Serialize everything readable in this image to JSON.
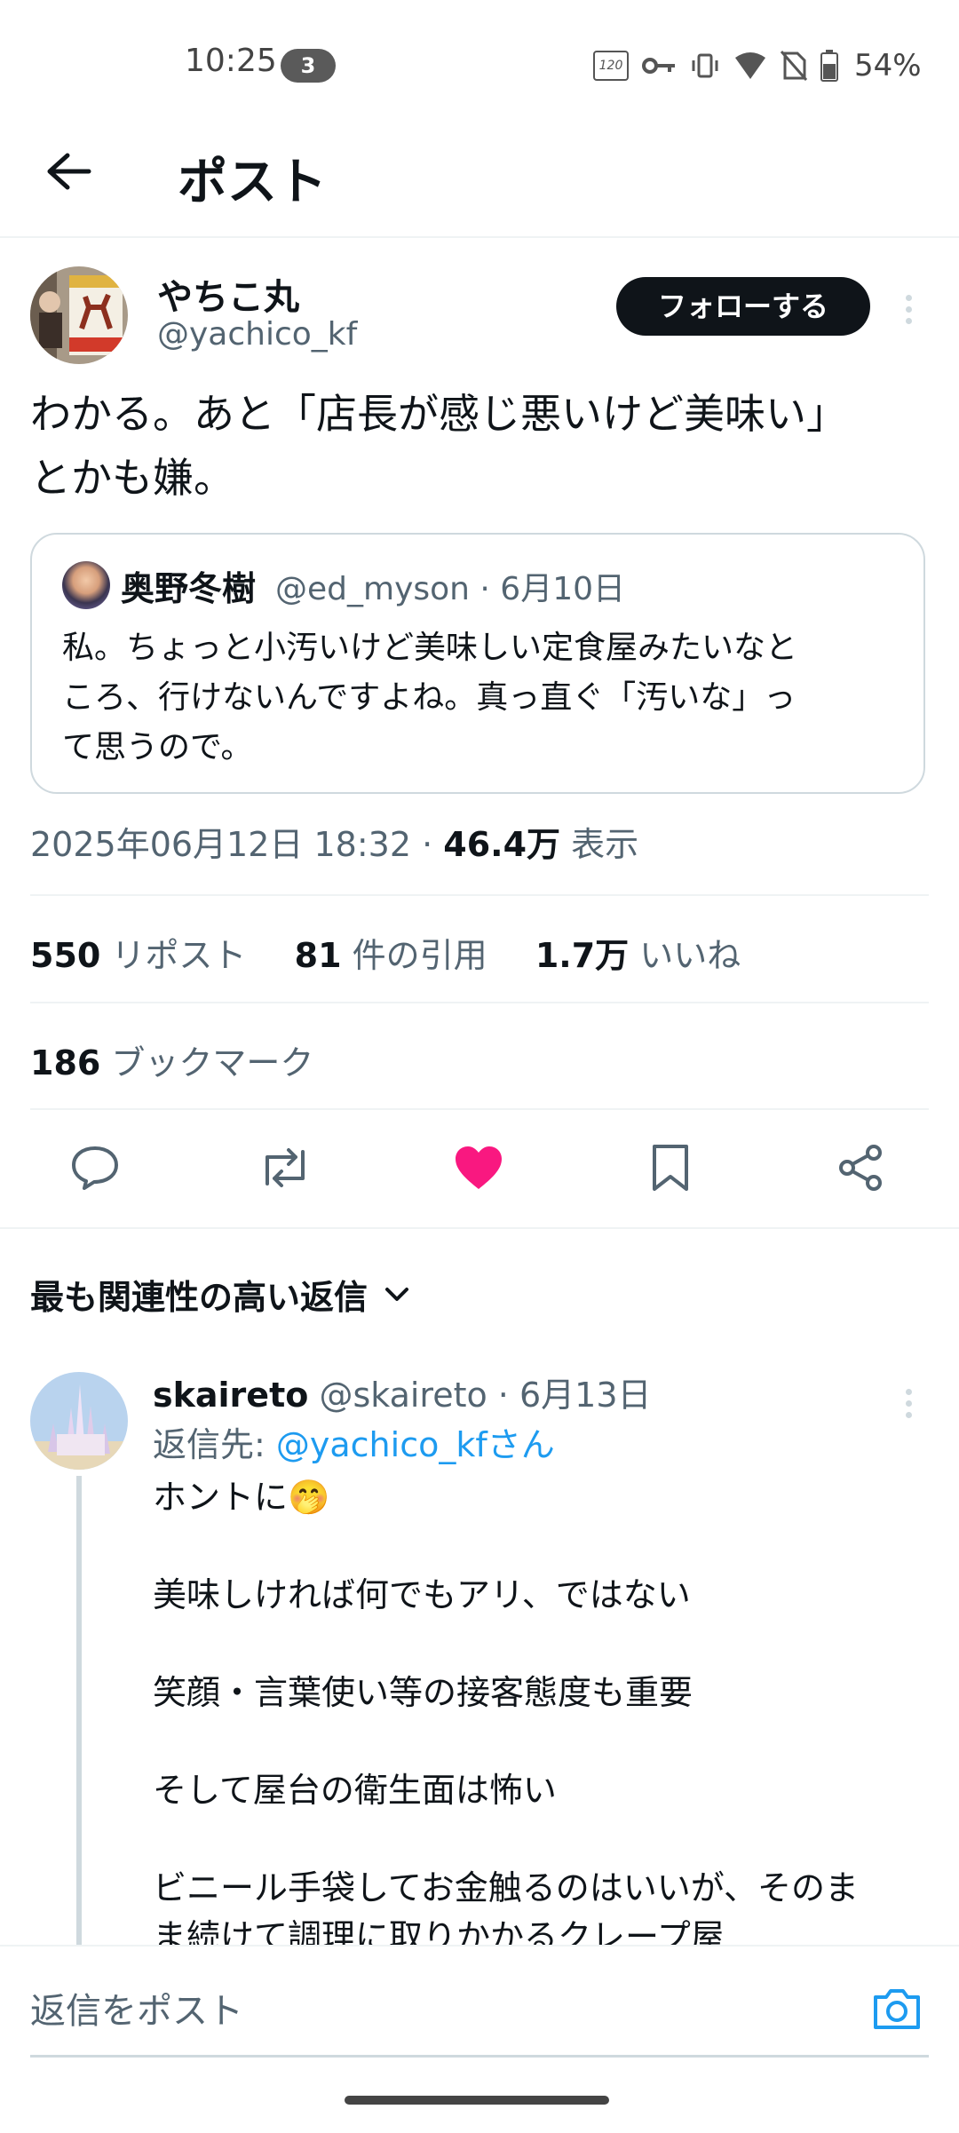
{
  "status_bar": {
    "time": "10:25",
    "notification_count": "3",
    "battery": "54%",
    "refresh_rate": "120"
  },
  "header": {
    "title": "ポスト"
  },
  "post": {
    "display_name": "やちこ丸",
    "handle": "@yachico_kf",
    "follow_label": "フォローする",
    "text_line1": "わかる。あと「店長が感じ悪いけど美味い」",
    "text_line2": "とかも嫌。",
    "quote": {
      "display_name": "奥野冬樹",
      "meta": "@ed_myson · 6月10日",
      "text_line1": "私。ちょっと小汚いけど美味しい定食屋みたいなと",
      "text_line2": "ころ、行けないんですよね。真っ直ぐ「汚いな」っ",
      "text_line3": "て思うので。"
    },
    "timestamp": "2025年06月12日 18:32",
    "separator": " · ",
    "views": "46.4万",
    "views_label": "表示",
    "reposts": "550",
    "reposts_label": "リポスト",
    "quotes": "81",
    "quotes_label": "件の引用",
    "likes": "1.7万",
    "likes_label": "いいね",
    "bookmarks": "186",
    "bookmarks_label": "ブックマーク"
  },
  "replies": {
    "sort_label": "最も関連性の高い返信",
    "items": [
      {
        "display_name": "skaireto",
        "meta": "@skaireto · 6月13日",
        "reply_to_prefix": "返信先: ",
        "reply_to_handle": "@yachico_kfさん",
        "line1": "ホントに🤭",
        "line2": "美味しければ何でもアリ、ではない",
        "line3": "笑顔・言葉使い等の接客態度も重要",
        "line4": "そして屋台の衛生面は怖い",
        "line5": "ビニール手袋してお金触るのはいいが、そのま",
        "line6": "ま続けて調理に取りかかるクレープ屋"
      }
    ]
  },
  "compose": {
    "placeholder": "返信をポスト"
  },
  "colors": {
    "accent": "#1d9bf0",
    "like": "#f91880",
    "text": "#0f1419",
    "muted": "#536471"
  }
}
